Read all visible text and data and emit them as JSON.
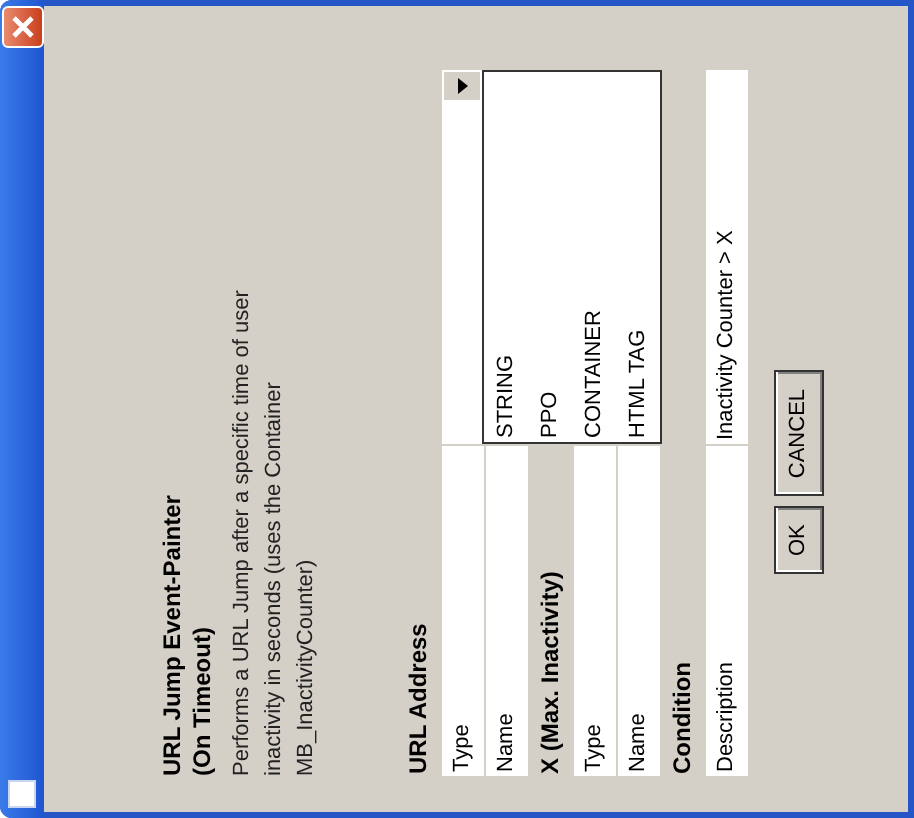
{
  "heading_lines": [
    "URL Jump Event-Painter",
    "(On Timeout)"
  ],
  "description_lines": [
    "Performs a URL Jump after a specific time of user",
    "inactivity in seconds (uses the Container",
    "MB_InactivityCounter)"
  ],
  "rows": [
    {
      "kind": "section",
      "label": "URL Address"
    },
    {
      "kind": "combo",
      "label": "Type",
      "options": [
        "STRING",
        "PPO",
        "CONTAINER",
        "HTML TAG"
      ]
    },
    {
      "kind": "field",
      "label": "Name"
    },
    {
      "kind": "section",
      "label": "X (Max. Inactivity)"
    },
    {
      "kind": "field",
      "label": "Type"
    },
    {
      "kind": "field",
      "label": "Name"
    },
    {
      "kind": "section",
      "label": "Condition"
    },
    {
      "kind": "field",
      "label": "Description",
      "value": "Inactivity Counter > X"
    }
  ],
  "buttons": [
    "OK",
    "CANCEL"
  ]
}
